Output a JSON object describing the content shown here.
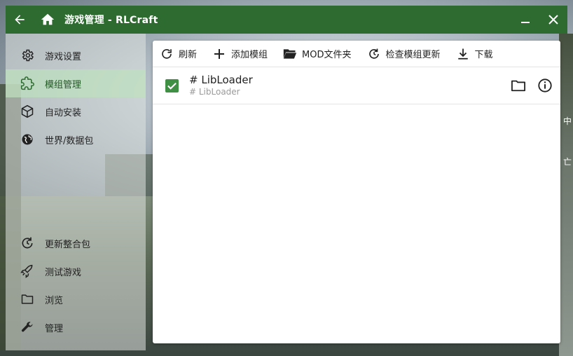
{
  "window": {
    "title": "游戏管理 - RLCraft",
    "accent": "#2e6b30"
  },
  "sidebar": {
    "items": [
      {
        "label": "游戏设置",
        "icon": "gear-icon"
      },
      {
        "label": "模组管理",
        "icon": "puzzle-icon",
        "active": true
      },
      {
        "label": "自动安装",
        "icon": "cube-icon"
      },
      {
        "label": "世界/数据包",
        "icon": "globe-icon"
      }
    ],
    "bottom_items": [
      {
        "label": "更新整合包",
        "icon": "update-icon"
      },
      {
        "label": "测试游戏",
        "icon": "rocket-icon"
      },
      {
        "label": "浏览",
        "icon": "folder-icon"
      },
      {
        "label": "管理",
        "icon": "wrench-icon"
      }
    ]
  },
  "toolbar": {
    "refresh": "刷新",
    "add_mod": "添加模组",
    "mod_folder": "MOD文件夹",
    "check_updates": "检查模组更新",
    "download": "下载"
  },
  "mods": [
    {
      "name": "# LibLoader",
      "subtitle": "# LibLoader",
      "enabled": true
    }
  ],
  "background_text": [
    "中",
    "亡"
  ]
}
